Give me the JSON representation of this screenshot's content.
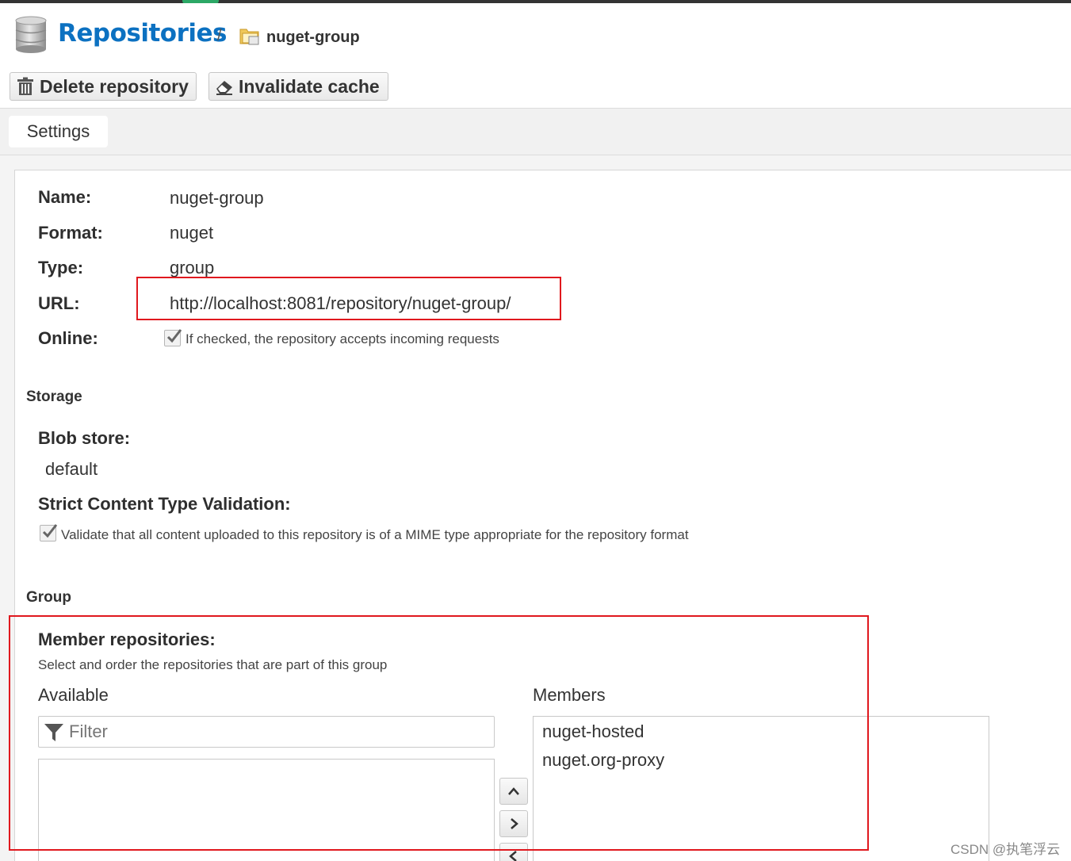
{
  "header": {
    "title": "Repositories",
    "separator": "/",
    "repository_name": "nuget-group"
  },
  "toolbar": {
    "delete_label": "Delete repository",
    "invalidate_label": "Invalidate cache"
  },
  "tabs": [
    {
      "label": "Settings"
    }
  ],
  "fields": {
    "name_label": "Name:",
    "name_value": "nuget-group",
    "format_label": "Format:",
    "format_value": "nuget",
    "type_label": "Type:",
    "type_value": "group",
    "url_label": "URL:",
    "url_value": "http://localhost:8081/repository/nuget-group/",
    "online_label": "Online:",
    "online_checked": true,
    "online_help": "If checked, the repository accepts incoming requests"
  },
  "storage": {
    "section": "Storage",
    "blob_store_label": "Blob store:",
    "blob_store_value": "default",
    "strict_label": "Strict Content Type Validation:",
    "strict_checked": true,
    "strict_help": "Validate that all content uploaded to this repository is of a MIME type appropriate for the repository format"
  },
  "group": {
    "section": "Group",
    "members_label": "Member repositories:",
    "members_help": "Select and order the repositories that are part of this group",
    "available_label": "Available",
    "members_column_label": "Members",
    "filter_placeholder": "Filter",
    "available": [],
    "members": [
      "nuget-hosted",
      "nuget.org-proxy"
    ]
  },
  "watermark": "CSDN @执笔浮云",
  "colors": {
    "title_blue": "#0c71c1",
    "highlight_red": "#e0181e",
    "accent_green": "#2ca866"
  }
}
